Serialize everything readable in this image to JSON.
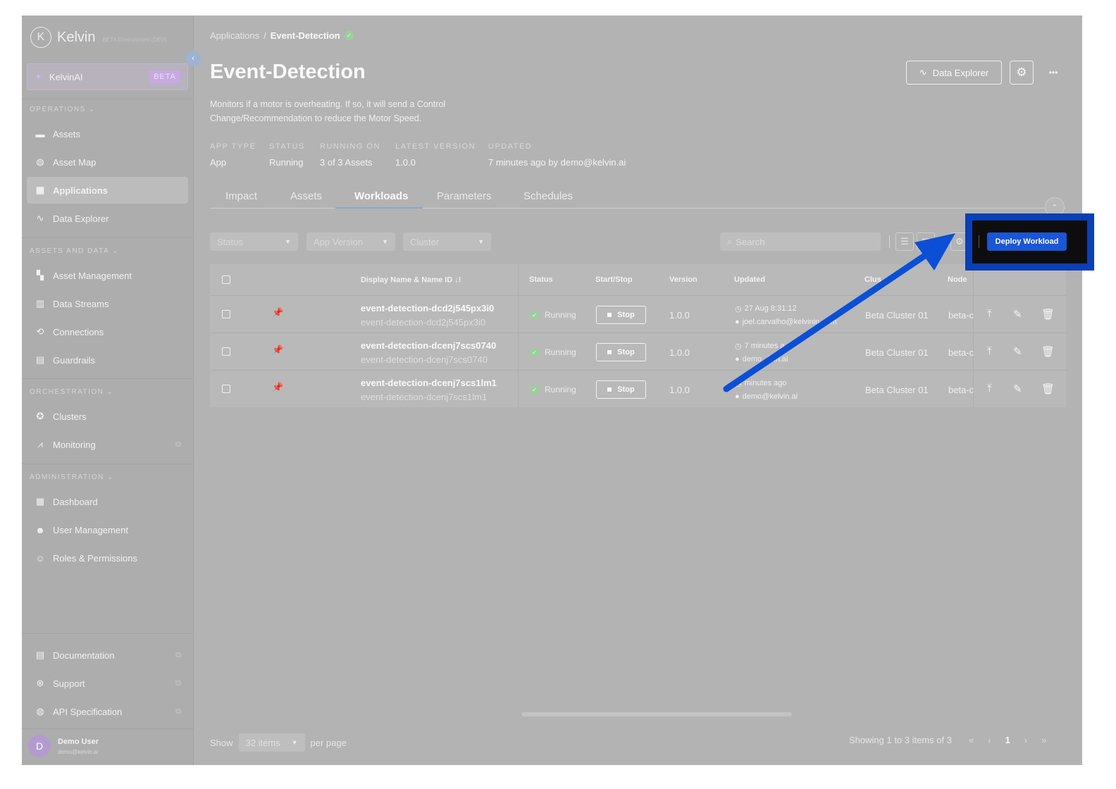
{
  "sidebar": {
    "brand": "Kelvin",
    "env_label": "BETA Environment (DEV)",
    "ai": {
      "label": "KelvinAI",
      "badge": "BETA"
    },
    "sections": [
      {
        "title": "OPERATIONS"
      },
      {
        "title": "ASSETS AND DATA"
      },
      {
        "title": "ORCHESTRATION"
      },
      {
        "title": "ADMINISTRATION"
      }
    ],
    "items": [
      {
        "label": "Assets",
        "icon": "briefcase-icon"
      },
      {
        "label": "Asset Map",
        "icon": "globe-icon"
      },
      {
        "label": "Applications",
        "icon": "apps-icon"
      },
      {
        "label": "Data Explorer",
        "icon": "pulse-icon"
      },
      {
        "label": "Asset Management",
        "icon": "asset-management-icon"
      },
      {
        "label": "Data Streams",
        "icon": "bar-chart-icon"
      },
      {
        "label": "Connections",
        "icon": "connections-icon"
      },
      {
        "label": "Guardrails",
        "icon": "guardrail-icon"
      },
      {
        "label": "Clusters",
        "icon": "cluster-icon"
      },
      {
        "label": "Monitoring",
        "icon": "monitoring-icon"
      },
      {
        "label": "Dashboard",
        "icon": "dashboard-icon"
      },
      {
        "label": "User Management",
        "icon": "users-icon"
      },
      {
        "label": "Roles & Permissions",
        "icon": "roles-icon"
      }
    ],
    "footer_items": [
      {
        "label": "Documentation",
        "icon": "document-icon"
      },
      {
        "label": "Support",
        "icon": "lifebuoy-icon"
      },
      {
        "label": "API Specification",
        "icon": "globe-icon"
      }
    ],
    "user": {
      "initial": "D",
      "name": "Demo User",
      "email": "demo@kelvin.ai"
    }
  },
  "breadcrumb": {
    "parent": "Applications",
    "separator": "/",
    "current": "Event-Detection"
  },
  "page": {
    "title": "Event-Detection",
    "description": "Monitors if a motor is overheating. If so, it will send a Control Change/Recommendation to reduce the Motor Speed.",
    "data_explorer_label": "Data Explorer",
    "more_label": "•••",
    "meta": [
      {
        "key": "APP TYPE",
        "value": "App"
      },
      {
        "key": "STATUS",
        "value": "Running"
      },
      {
        "key": "RUNNING ON",
        "value": "3 of 3 Assets"
      },
      {
        "key": "LATEST VERSION",
        "value": "1.0.0"
      },
      {
        "key": "UPDATED",
        "value": "7 minutes ago by demo@kelvin.ai"
      }
    ]
  },
  "tabs": [
    {
      "label": "Impact"
    },
    {
      "label": "Assets"
    },
    {
      "label": "Workloads",
      "active": true
    },
    {
      "label": "Parameters"
    },
    {
      "label": "Schedules"
    }
  ],
  "filters": {
    "status": "Status",
    "app_version": "App Version",
    "cluster": "Cluster",
    "search_placeholder": "Search",
    "deploy_label": "Deploy Workload"
  },
  "table": {
    "columns": [
      "Display Name & Name ID",
      "Status",
      "Start/Stop",
      "Version",
      "Updated",
      "Clus",
      "Node"
    ],
    "sort_indicator": "↓⁝",
    "rows": [
      {
        "display_name": "event-detection-dcd2j545px3i0",
        "name_id": "event-detection-dcd2j545px3i0",
        "status": "Running",
        "stop_label": "Stop",
        "version": "1.0.0",
        "updated": "27 Aug 8:31:12",
        "updated_by": "joel.carvalho@kelvinin...om",
        "cluster": "Beta Cluster 01",
        "node": "beta-c"
      },
      {
        "display_name": "event-detection-dcenj7scs0740",
        "name_id": "event-detection-dcenj7scs0740",
        "status": "Running",
        "stop_label": "Stop",
        "version": "1.0.0",
        "updated": "7 minutes a",
        "updated_by": "demo...lvin.ai",
        "cluster": "Beta Cluster 01",
        "node": "beta-c"
      },
      {
        "display_name": "event-detection-dcenj7scs1lm1",
        "name_id": "event-detection-dcenj7scs1lm1",
        "status": "Running",
        "stop_label": "Stop",
        "version": "1.0.0",
        "updated": "minutes ago",
        "updated_by": "demo@kelvin.ai",
        "cluster": "Beta Cluster 01",
        "node": "beta-c"
      }
    ]
  },
  "pagination": {
    "show": "Show",
    "per_page_value": "32 items",
    "per_page": "per page",
    "summary": "Showing 1 to 3 items of 3",
    "first": "«",
    "prev": "‹",
    "page": "1",
    "next": "›",
    "last": "»"
  },
  "colors": {
    "accent": "#1a56d6",
    "highlight_border": "#0a3fb5",
    "overlay": "#b3b3b3"
  }
}
